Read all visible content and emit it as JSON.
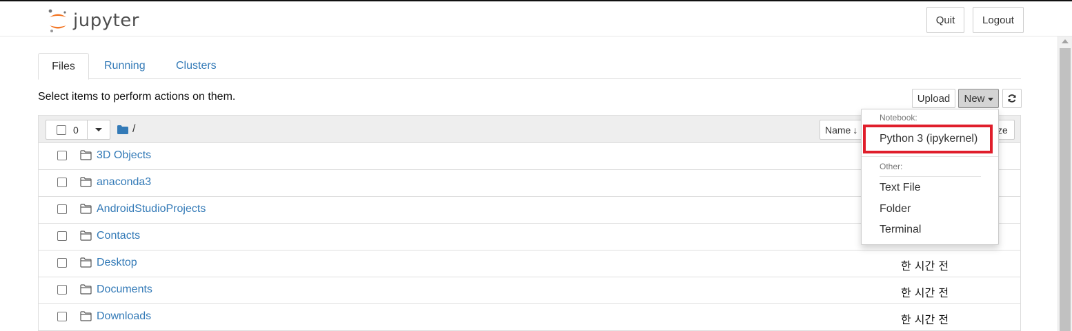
{
  "header": {
    "logo_text": "jupyter",
    "quit_label": "Quit",
    "logout_label": "Logout"
  },
  "tabs": [
    {
      "label": "Files",
      "active": true
    },
    {
      "label": "Running",
      "active": false
    },
    {
      "label": "Clusters",
      "active": false
    }
  ],
  "toolbar": {
    "hint": "Select items to perform actions on them.",
    "upload_label": "Upload",
    "new_label": "New",
    "refresh_icon": "refresh-icon"
  },
  "list": {
    "selected_count": "0",
    "breadcrumb": "/",
    "sort_name_label": "Name",
    "sort_arrow": "↓",
    "size_label_partial": "ze",
    "rows": [
      {
        "name": "3D Objects",
        "modified": ""
      },
      {
        "name": "anaconda3",
        "modified": ""
      },
      {
        "name": "AndroidStudioProjects",
        "modified": ""
      },
      {
        "name": "Contacts",
        "modified": ""
      },
      {
        "name": "Desktop",
        "modified": "한 시간 전"
      },
      {
        "name": "Documents",
        "modified": "한 시간 전"
      },
      {
        "name": "Downloads",
        "modified": "한 시간 전"
      }
    ]
  },
  "new_menu": {
    "notebook_header": "Notebook:",
    "python_kernel": "Python 3 (ipykernel)",
    "other_header": "Other:",
    "text_file": "Text File",
    "folder": "Folder",
    "terminal": "Terminal"
  },
  "colors": {
    "link": "#337ab7",
    "highlight": "#e01e2b",
    "logo_orange": "#f37726"
  }
}
